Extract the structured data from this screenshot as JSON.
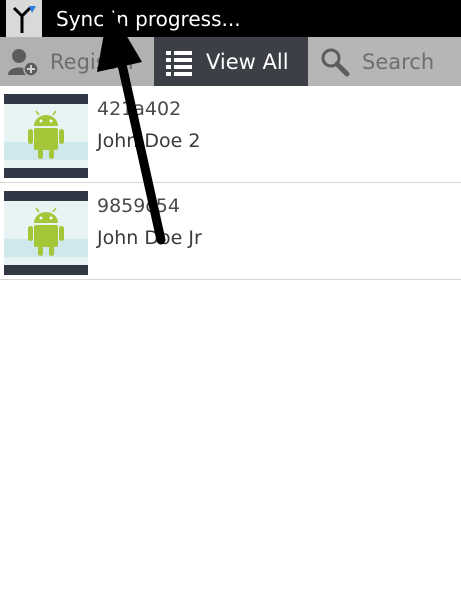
{
  "statusbar": {
    "app_icon": "antenna-sync-icon",
    "text": "Sync in progress..."
  },
  "tabs": [
    {
      "label": "Register",
      "icon": "add-user-icon",
      "selected": false
    },
    {
      "label": "View All",
      "icon": "list-icon",
      "selected": true
    },
    {
      "label": "Search",
      "icon": "search-icon",
      "selected": false
    }
  ],
  "list": {
    "items": [
      {
        "id": "421a402",
        "name": "John Doe 2",
        "thumbnail_icon": "android-robot-icon"
      },
      {
        "id": "9859c54",
        "name": "John Doe Jr",
        "thumbnail_icon": "android-robot-icon"
      }
    ]
  },
  "colors": {
    "statusbar_bg": "#000000",
    "tab_selected_bg": "#3d3f47",
    "tab_unselected_bg": "#b5b6b5",
    "android_green": "#a4c639",
    "annotation_arrow": "#000000"
  }
}
